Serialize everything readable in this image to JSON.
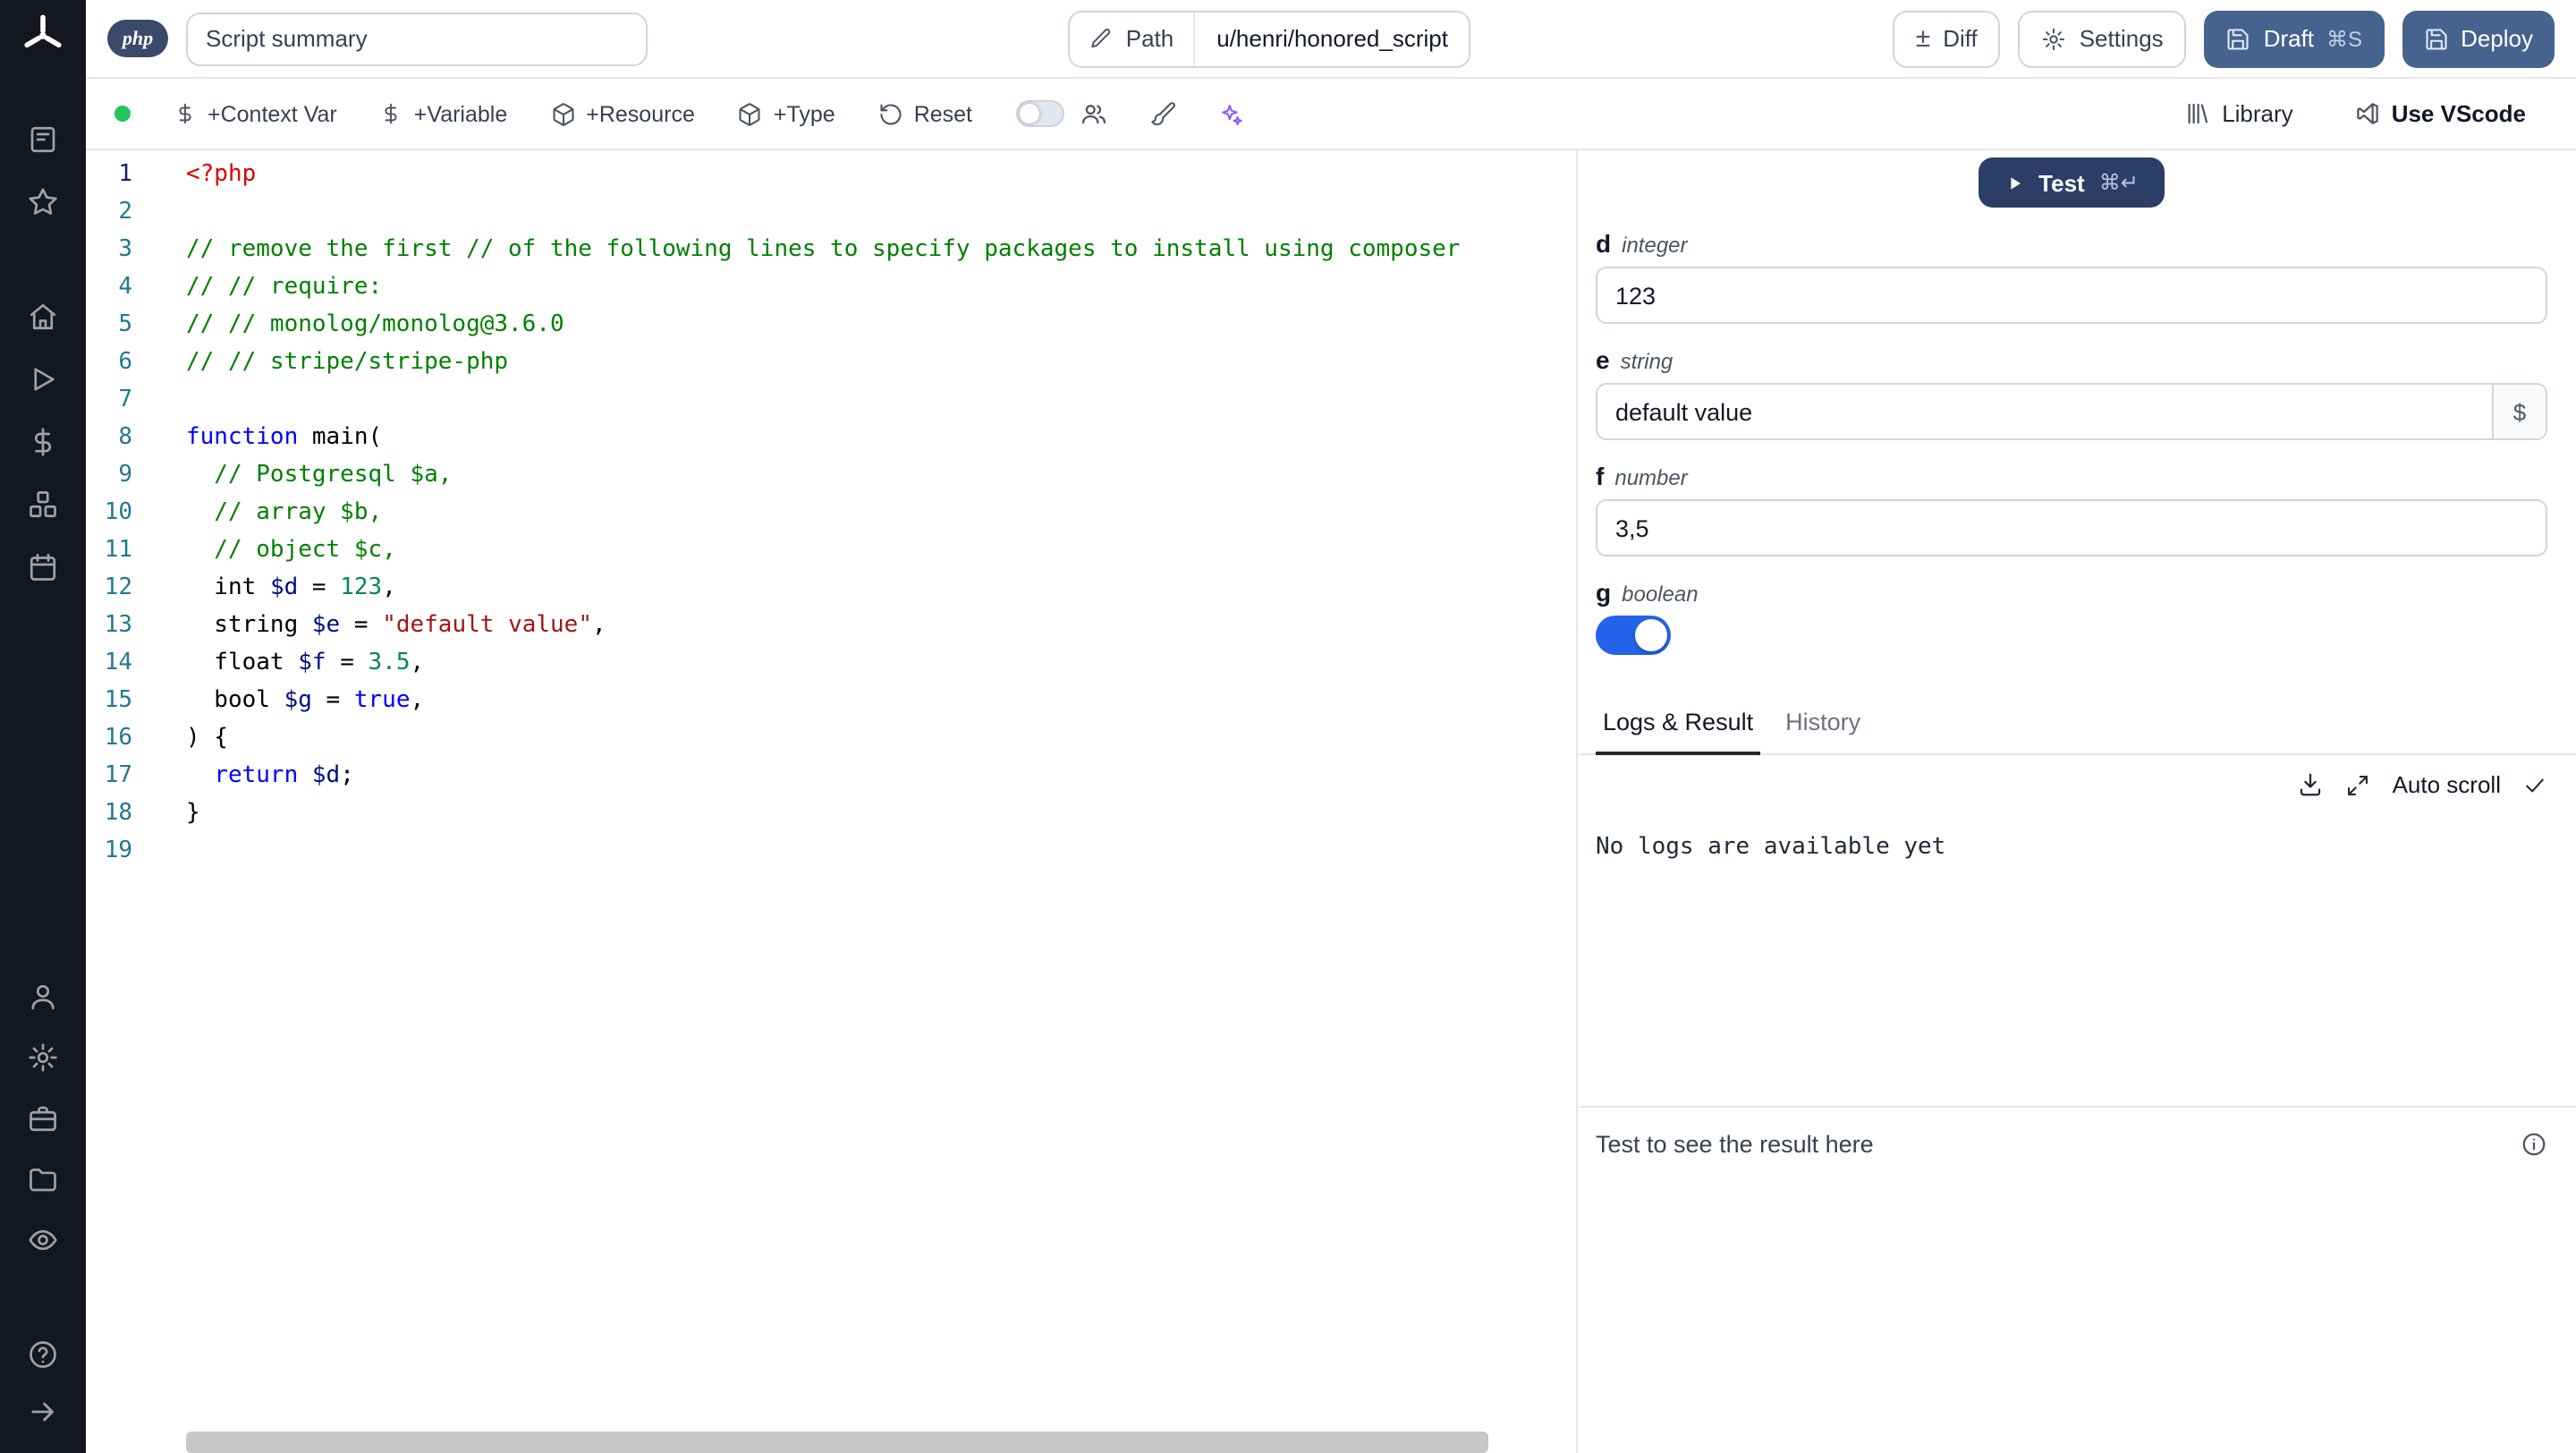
{
  "colors": {
    "accent": "#2563eb",
    "test_button": "#2c3e66",
    "draft_button": "#46638f",
    "status_dot": "#22c55e",
    "sparkles": "#8b5cf6",
    "tok_tag": "#dd0000",
    "tok_comment": "#008000",
    "tok_keyword": "#0000ff",
    "tok_variable": "#001080",
    "tok_number": "#098658",
    "tok_string": "#a31515",
    "line_number": "#237893",
    "line_number_active": "#0b216f"
  },
  "icons": [
    "windmill-logo",
    "workspace-icon",
    "star-icon",
    "home-icon",
    "play-icon",
    "dollar-icon",
    "boxes-icon",
    "calendar-icon",
    "user-icon",
    "gear-icon",
    "toolbox-icon",
    "folder-icon",
    "eye-icon",
    "help-icon",
    "arrow-right-icon",
    "pencil-icon",
    "plus-minus-icon",
    "save-icon",
    "package-icon",
    "reset-icon",
    "users-icon",
    "brush-icon",
    "sparkles-icon",
    "library-icon",
    "vscode-icon",
    "play-solid-icon",
    "download-icon",
    "expand-icon",
    "check-icon",
    "info-icon"
  ],
  "sidebar": {
    "groups": {
      "top": [
        "workspace",
        "star"
      ],
      "nav": [
        "home",
        "play",
        "dollar",
        "boxes",
        "calendar"
      ],
      "lower": [
        "user",
        "gear",
        "toolbox",
        "folder",
        "eye"
      ],
      "bottom": [
        "help",
        "arrow-right"
      ]
    }
  },
  "header": {
    "language_badge": "php",
    "summary_value": "Script summary",
    "path_label": "Path",
    "path_value": "u/henri/honored_script",
    "diff_label": "Diff",
    "settings_label": "Settings",
    "draft_label": "Draft",
    "draft_shortcut": "⌘S",
    "deploy_label": "Deploy"
  },
  "toolbar": {
    "context_var_label": "+Context Var",
    "variable_label": "+Variable",
    "resource_label": "+Resource",
    "type_label": "+Type",
    "reset_label": "Reset",
    "library_label": "Library",
    "vscode_label": "Use VScode"
  },
  "editor": {
    "active_line": 1,
    "lines": [
      {
        "n": 1,
        "seg": [
          [
            "tag",
            "<?php"
          ]
        ]
      },
      {
        "n": 2,
        "seg": []
      },
      {
        "n": 3,
        "seg": [
          [
            "com",
            "// remove the first // of the following lines to specify packages to install using composer"
          ]
        ]
      },
      {
        "n": 4,
        "seg": [
          [
            "com",
            "// // require:"
          ]
        ]
      },
      {
        "n": 5,
        "seg": [
          [
            "com",
            "// // monolog/monolog@3.6.0"
          ]
        ]
      },
      {
        "n": 6,
        "seg": [
          [
            "com",
            "// // stripe/stripe-php"
          ]
        ]
      },
      {
        "n": 7,
        "seg": []
      },
      {
        "n": 8,
        "seg": [
          [
            "kw",
            "function"
          ],
          [
            "pl",
            " main("
          ]
        ]
      },
      {
        "n": 9,
        "seg": [
          [
            "com",
            "  // Postgresql $a,"
          ]
        ]
      },
      {
        "n": 10,
        "seg": [
          [
            "com",
            "  // array $b,"
          ]
        ]
      },
      {
        "n": 11,
        "seg": [
          [
            "com",
            "  // object $c,"
          ]
        ]
      },
      {
        "n": 12,
        "seg": [
          [
            "pl",
            "  int "
          ],
          [
            "var",
            "$d"
          ],
          [
            "pl",
            " = "
          ],
          [
            "num",
            "123"
          ],
          [
            "pl",
            ","
          ]
        ]
      },
      {
        "n": 13,
        "seg": [
          [
            "pl",
            "  string "
          ],
          [
            "var",
            "$e"
          ],
          [
            "pl",
            " = "
          ],
          [
            "str",
            "\"default value\""
          ],
          [
            "pl",
            ","
          ]
        ]
      },
      {
        "n": 14,
        "seg": [
          [
            "pl",
            "  float "
          ],
          [
            "var",
            "$f"
          ],
          [
            "pl",
            " = "
          ],
          [
            "num",
            "3.5"
          ],
          [
            "pl",
            ","
          ]
        ]
      },
      {
        "n": 15,
        "seg": [
          [
            "pl",
            "  bool "
          ],
          [
            "var",
            "$g"
          ],
          [
            "pl",
            " = "
          ],
          [
            "kw",
            "true"
          ],
          [
            "pl",
            ","
          ]
        ]
      },
      {
        "n": 16,
        "seg": [
          [
            "pl",
            ") {"
          ]
        ]
      },
      {
        "n": 17,
        "seg": [
          [
            "pl",
            "  "
          ],
          [
            "kw",
            "return"
          ],
          [
            "pl",
            " "
          ],
          [
            "var",
            "$d"
          ],
          [
            "pl",
            ";"
          ]
        ]
      },
      {
        "n": 18,
        "seg": [
          [
            "pl",
            "}"
          ]
        ]
      },
      {
        "n": 19,
        "seg": []
      }
    ]
  },
  "test": {
    "label": "Test",
    "shortcut": "⌘↵"
  },
  "form": {
    "fields": [
      {
        "name": "d",
        "type": "integer",
        "value": "123"
      },
      {
        "name": "e",
        "type": "string",
        "value": "default value",
        "dollar": "$"
      },
      {
        "name": "f",
        "type": "number",
        "value": "3,5"
      },
      {
        "name": "g",
        "type": "boolean",
        "state": "on"
      }
    ]
  },
  "tabs": {
    "logs": "Logs & Result",
    "history": "History"
  },
  "logs": {
    "auto_scroll_label": "Auto scroll",
    "empty_message": "No logs are available yet"
  },
  "result": {
    "hint": "Test to see the result here"
  }
}
